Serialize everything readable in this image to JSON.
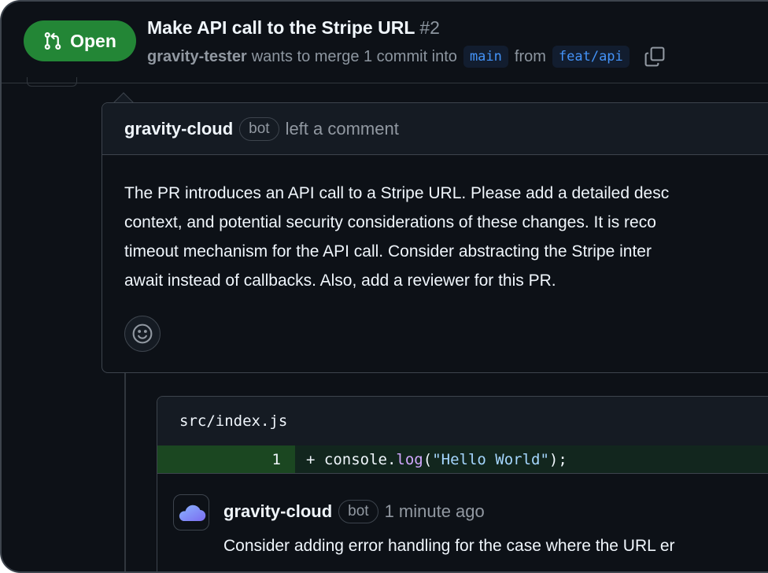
{
  "header": {
    "state_label": "Open",
    "title": "Make API call to the Stripe URL",
    "number": "#2",
    "author": "gravity-tester",
    "merge_text": "wants to merge 1 commit into",
    "base_branch": "main",
    "from_text": "from",
    "head_branch": "feat/api",
    "icons": {
      "state": "git-pull-request-icon",
      "copy": "copy-icon"
    }
  },
  "comment": {
    "author": "gravity-cloud",
    "bot_label": "bot",
    "action": "left a comment",
    "body_lines": [
      "The PR introduces an API call to a Stripe URL. Please add a detailed desc",
      "context, and potential security considerations of these changes. It is reco",
      "timeout mechanism for the API call. Consider abstracting the Stripe inter",
      "await instead of callbacks. Also, add a reviewer for this PR."
    ],
    "reaction_icon": "smiley-icon"
  },
  "review": {
    "file_path": "src/index.js",
    "diff": {
      "line_number": "1",
      "prefix": "+ ",
      "object": "console",
      "dot": ".",
      "method": "log",
      "open_paren": "(",
      "string": "\"Hello World\"",
      "close": ");"
    },
    "reply": {
      "author": "gravity-cloud",
      "bot_label": "bot",
      "time": "1 minute ago",
      "text": "Consider adding error handling for the case where the URL er",
      "avatar_icon": "cloud-icon"
    }
  },
  "colors": {
    "background": "#0d1117",
    "open_green": "#238636",
    "branch_blue": "#4493f8",
    "diff_added": "#12261e"
  }
}
